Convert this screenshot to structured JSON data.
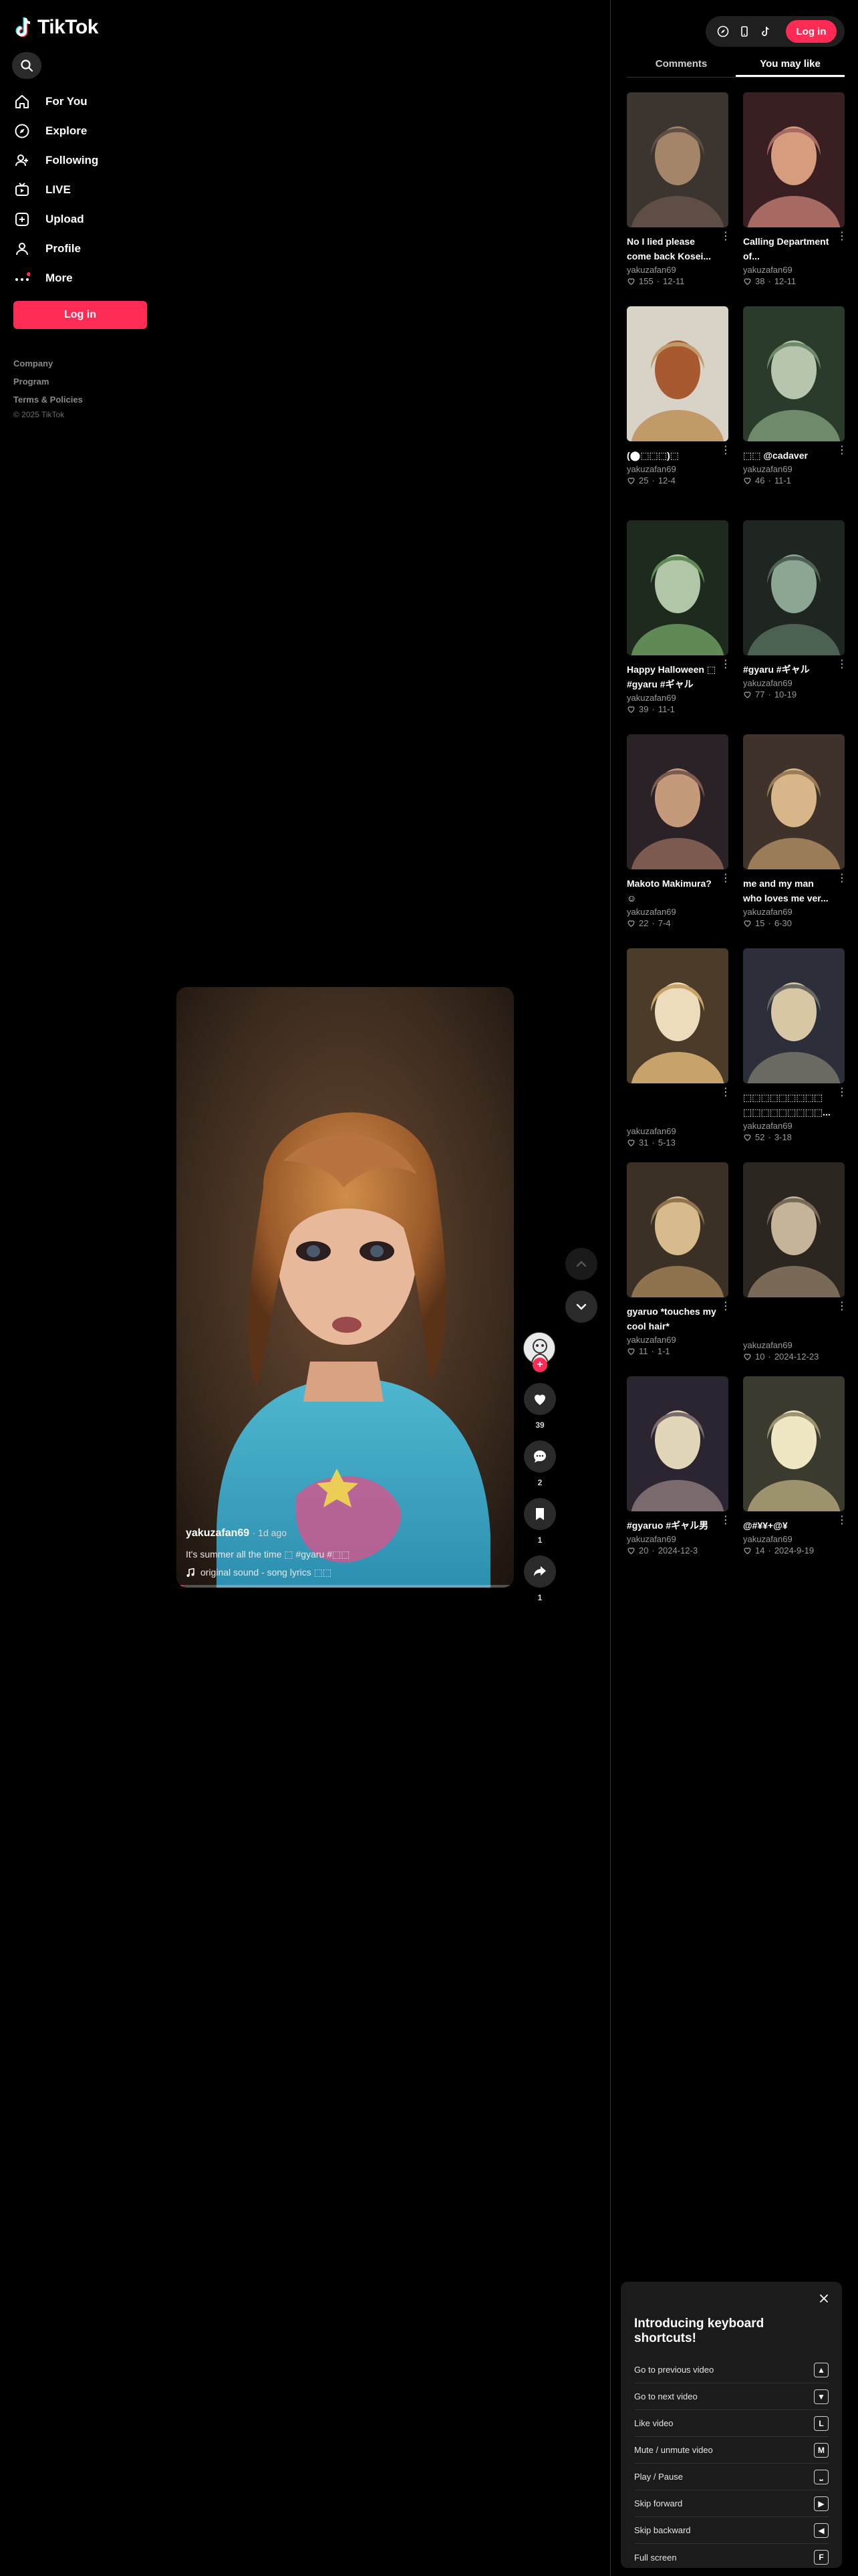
{
  "app": {
    "name": "TikTok"
  },
  "sidebar": {
    "items": [
      {
        "label": "For You",
        "icon": "home-icon"
      },
      {
        "label": "Explore",
        "icon": "compass-icon"
      },
      {
        "label": "Following",
        "icon": "following-icon"
      },
      {
        "label": "LIVE",
        "icon": "live-icon"
      },
      {
        "label": "Upload",
        "icon": "upload-icon"
      },
      {
        "label": "Profile",
        "icon": "profile-icon"
      },
      {
        "label": "More",
        "icon": "more-dots-icon"
      }
    ],
    "login_label": "Log in",
    "footer": {
      "company": "Company",
      "program": "Program",
      "terms": "Terms & Policies",
      "copyright": "© 2025 TikTok"
    }
  },
  "video": {
    "author": "yakuzafan69",
    "time": "· 1d ago",
    "caption": "It's summer all the time ⬚ #gyaru #⬚⬚",
    "sound": "original sound - song lyrics ⬚⬚",
    "progress": 0.02,
    "like_count": "39",
    "comment_count": "2",
    "save_count": "1",
    "share_count": "1"
  },
  "top": {
    "login_label": "Log in"
  },
  "tabs": [
    {
      "label": "Comments",
      "active": false
    },
    {
      "label": "You may like",
      "active": true
    }
  ],
  "recommendations": [
    {
      "title": "No I lied please come back Kosei...",
      "author": "yakuzafan69",
      "likes": "155",
      "date": "12-11",
      "palette": [
        "#3b342f",
        "#5e4e45",
        "#a48569"
      ]
    },
    {
      "title": "Calling Department of...",
      "author": "yakuzafan69",
      "likes": "38",
      "date": "12-11",
      "palette": [
        "#3a1f22",
        "#a66a62",
        "#d59c7d"
      ]
    },
    {
      "title": "(⬤⬚⬚⬚)⬚",
      "author": "yakuzafan69",
      "likes": "25",
      "date": "12-4",
      "palette": [
        "#d9d2c7",
        "#c29a6a",
        "#a7592f"
      ]
    },
    {
      "title": "⬚⬚ @cadaver",
      "author": "yakuzafan69",
      "likes": "46",
      "date": "11-1",
      "palette": [
        "#2a3a2b",
        "#6e8a6a",
        "#b7c4ae"
      ]
    },
    {
      "title": "Happy Halloween ⬚ #gyaru #ギャル",
      "author": "yakuzafan69",
      "likes": "39",
      "date": "11-1",
      "palette": [
        "#1d2a1d",
        "#5f8a55",
        "#b1c6a6"
      ]
    },
    {
      "title": "#gyaru #ギャル",
      "author": "yakuzafan69",
      "likes": "77",
      "date": "10-19",
      "palette": [
        "#1f2520",
        "#4d6152",
        "#8da593"
      ]
    },
    {
      "title": "Makoto Makimura? ☺",
      "author": "yakuzafan69",
      "likes": "22",
      "date": "7-4",
      "palette": [
        "#2b2228",
        "#7d5a4f",
        "#c49a7b"
      ]
    },
    {
      "title": "me and my man who loves me ver...",
      "author": "yakuzafan69",
      "likes": "15",
      "date": "6-30",
      "palette": [
        "#3e322a",
        "#9a7c58",
        "#d9b68a"
      ]
    },
    {
      "title": "",
      "author": "yakuzafan69",
      "likes": "31",
      "date": "5-13",
      "palette": [
        "#4b3c2a",
        "#c7a26a",
        "#ecdcbc"
      ]
    },
    {
      "title": "⬚⬚⬚⬚⬚⬚⬚⬚⬚ ⬚⬚⬚⬚⬚⬚⬚⬚⬚...",
      "author": "yakuzafan69",
      "likes": "52",
      "date": "3-18",
      "palette": [
        "#2c2f3a",
        "#6a6a62",
        "#d8c7a4"
      ]
    },
    {
      "title": "gyaruo *touches my cool hair*",
      "author": "yakuzafan69",
      "likes": "11",
      "date": "1-1",
      "palette": [
        "#3a3026",
        "#8f734e",
        "#d8bb8c"
      ]
    },
    {
      "title": "",
      "author": "yakuzafan69",
      "likes": "10",
      "date": "2024-12-23",
      "palette": [
        "#2b2620",
        "#786a56",
        "#c6b498"
      ]
    },
    {
      "title": "#gyaruo #ギャル男",
      "author": "yakuzafan69",
      "likes": "20",
      "date": "2024-12-3",
      "palette": [
        "#2a2530",
        "#7a6a6e",
        "#e2d6b8"
      ]
    },
    {
      "title": "@#¥¥+@¥",
      "author": "yakuzafan69",
      "likes": "14",
      "date": "2024-9-19",
      "palette": [
        "#3a3a2e",
        "#9c936e",
        "#efe6c4"
      ]
    }
  ],
  "shortcuts": {
    "title": "Introducing keyboard shortcuts!",
    "items": [
      {
        "label": "Go to previous video",
        "key": "▲"
      },
      {
        "label": "Go to next video",
        "key": "▼"
      },
      {
        "label": "Like video",
        "key": "L"
      },
      {
        "label": "Mute / unmute video",
        "key": "M"
      },
      {
        "label": "Play / Pause",
        "key": "⎵"
      },
      {
        "label": "Skip forward",
        "key": "▶"
      },
      {
        "label": "Skip backward",
        "key": "◀"
      },
      {
        "label": "Full screen",
        "key": "F"
      }
    ]
  },
  "colors": {
    "accent": "#fe2c55",
    "background": "#000000",
    "panel": "#1b1b1b"
  }
}
